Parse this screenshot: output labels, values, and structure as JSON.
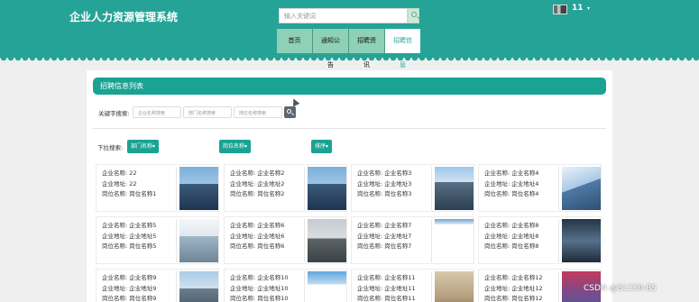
{
  "header": {
    "title": "企业人力资源管理系统",
    "search_placeholder": "输入关键词",
    "username": "11",
    "user_caret": "▾",
    "accent_color": "#26a397"
  },
  "nav": {
    "items": [
      {
        "label": "首页",
        "active": false
      },
      {
        "label": "通知公告",
        "active": false
      },
      {
        "label": "招聘资讯",
        "active": false
      },
      {
        "label": "招聘信息",
        "active": true
      }
    ]
  },
  "panel": {
    "title": "招聘信息列表",
    "keyword_label": "关键字搜索:",
    "inputs": [
      {
        "placeholder": "企业名称搜索"
      },
      {
        "placeholder": "部门名称搜索"
      },
      {
        "placeholder": "岗位名称搜索"
      }
    ],
    "dropdown_label": "下拉搜索:",
    "dropdowns": [
      {
        "label": "部门名称▾"
      },
      {
        "label": "岗位名称▾"
      },
      {
        "label": "排序▾"
      }
    ]
  },
  "cards": [
    {
      "company": "企业名称: 22",
      "address": "企业地址: 22",
      "position": "岗位名称: 岗位名称1",
      "image": "building-photo"
    },
    {
      "company": "企业名称: 企业名称2",
      "address": "企业地址: 企业地址2",
      "position": "岗位名称: 岗位名称2",
      "image": "building-photo"
    },
    {
      "company": "企业名称: 企业名称3",
      "address": "企业地址: 企业地址3",
      "position": "岗位名称: 岗位名称3",
      "image": "building-photo"
    },
    {
      "company": "企业名称: 企业名称4",
      "address": "企业地址: 企业地址4",
      "position": "岗位名称: 岗位名称4",
      "image": "building-photo"
    },
    {
      "company": "企业名称: 企业名称5",
      "address": "企业地址: 企业地址5",
      "position": "岗位名称: 岗位名称5",
      "image": "building-photo"
    },
    {
      "company": "企业名称: 企业名称6",
      "address": "企业地址: 企业地址6",
      "position": "岗位名称: 岗位名称6",
      "image": "building-photo"
    },
    {
      "company": "企业名称: 企业名称7",
      "address": "企业地址: 企业地址7",
      "position": "岗位名称: 岗位名称7",
      "image": "building-photo"
    },
    {
      "company": "企业名称: 企业名称8",
      "address": "企业地址: 企业地址8",
      "position": "岗位名称: 岗位名称8",
      "image": "building-photo"
    },
    {
      "company": "企业名称: 企业名称9",
      "address": "企业地址: 企业地址9",
      "position": "岗位名称: 岗位名称9",
      "image": "building-photo"
    },
    {
      "company": "企业名称: 企业名称10",
      "address": "企业地址: 企业地址10",
      "position": "岗位名称: 岗位名称10",
      "image": "building-photo"
    },
    {
      "company": "企业名称: 企业名称11",
      "address": "企业地址: 企业地址11",
      "position": "岗位名称: 岗位名称11",
      "image": "building-photo"
    },
    {
      "company": "企业名称: 企业名称12",
      "address": "企业地址: 企业地址12",
      "position": "岗位名称: 岗位名称12",
      "image": "building-photo"
    }
  ],
  "watermark": "CSDN @81330-BS"
}
